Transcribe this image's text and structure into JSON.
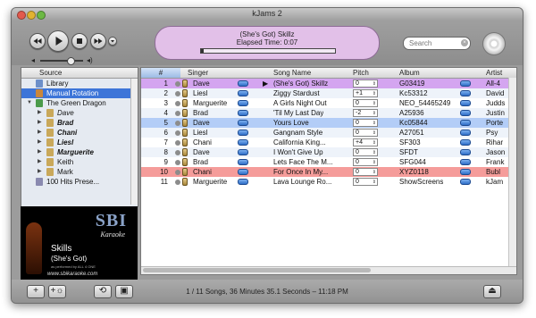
{
  "window": {
    "title": "kJams 2"
  },
  "now_playing": {
    "song": "(She's Got) Skillz",
    "elapsed": "Elapsed Time: 0:07",
    "progress": 0.02
  },
  "search": {
    "placeholder": "Search"
  },
  "sidebar": {
    "header": "Source",
    "items": [
      {
        "label": "Library",
        "indent": 0,
        "icon": "library-icon",
        "style": "normal",
        "selected": false,
        "triangle": ""
      },
      {
        "label": "Manual Rotation",
        "indent": 0,
        "icon": "manual-rotation-icon",
        "style": "normal",
        "selected": true,
        "triangle": ""
      },
      {
        "label": "The Green Dragon",
        "indent": 0,
        "icon": "venue-icon",
        "style": "normal",
        "selected": false,
        "triangle": "▼"
      },
      {
        "label": "Dave",
        "indent": 1,
        "icon": "singer-icon",
        "style": "italic",
        "selected": false,
        "triangle": "▶"
      },
      {
        "label": "Brad",
        "indent": 1,
        "icon": "singer-icon",
        "style": "bolditalic",
        "selected": false,
        "triangle": "▶"
      },
      {
        "label": "Chani",
        "indent": 1,
        "icon": "singer-icon",
        "style": "bolditalic",
        "selected": false,
        "triangle": "▶"
      },
      {
        "label": "Liesl",
        "indent": 1,
        "icon": "singer-icon",
        "style": "bolditalic",
        "selected": false,
        "triangle": "▶"
      },
      {
        "label": "Marguerite",
        "indent": 1,
        "icon": "singer-icon",
        "style": "bolditalic",
        "selected": false,
        "triangle": "▶"
      },
      {
        "label": "Keith",
        "indent": 1,
        "icon": "singer-icon",
        "style": "normal",
        "selected": false,
        "triangle": "▶"
      },
      {
        "label": "Mark",
        "indent": 1,
        "icon": "singer-icon",
        "style": "normal",
        "selected": false,
        "triangle": "▶"
      },
      {
        "label": "100 Hits Prese...",
        "indent": 0,
        "icon": "playlist-icon",
        "style": "normal",
        "selected": false,
        "triangle": ""
      }
    ]
  },
  "album_art": {
    "logo": "SBI",
    "logo_sub": "Karaoke",
    "title": "Skills",
    "subtitle": "(She's Got)",
    "credit": "as performed by ALL 4 ONE",
    "url": "www.sbikaraoke.com"
  },
  "columns": [
    "#",
    "Singer",
    "Song Name",
    "Pitch",
    "Album",
    "Artist"
  ],
  "rows": [
    {
      "num": "1",
      "singer": "Dave",
      "song": "(She's Got) Skillz",
      "pitch": "0",
      "album": "G03419",
      "artist": "All-4",
      "state": "playing",
      "speaker": "▶"
    },
    {
      "num": "2",
      "singer": "Liesl",
      "song": "Ziggy Stardust",
      "pitch": "+1",
      "album": "Kc53312",
      "artist": "David",
      "state": "",
      "speaker": ""
    },
    {
      "num": "3",
      "singer": "Marguerite",
      "song": "A Girls Night Out",
      "pitch": "0",
      "album": "NEO_54465249",
      "artist": "Judds",
      "state": "",
      "speaker": ""
    },
    {
      "num": "4",
      "singer": "Brad",
      "song": "'Til My Last Day",
      "pitch": "-2",
      "album": "A25936",
      "artist": "Justin",
      "state": "",
      "speaker": ""
    },
    {
      "num": "5",
      "singer": "Dave",
      "song": "Yours Love",
      "pitch": "0",
      "album": "Kc05844",
      "artist": "Porte",
      "state": "selected",
      "speaker": ""
    },
    {
      "num": "6",
      "singer": "Liesl",
      "song": "Gangnam Style",
      "pitch": "0",
      "album": "A27051",
      "artist": "Psy",
      "state": "",
      "speaker": ""
    },
    {
      "num": "7",
      "singer": "Chani",
      "song": "California King...",
      "pitch": "+4",
      "album": "SF303",
      "artist": "Rihar",
      "state": "",
      "speaker": ""
    },
    {
      "num": "8",
      "singer": "Dave",
      "song": "I Won't Give Up",
      "pitch": "0",
      "album": "SFDT",
      "artist": "Jason",
      "state": "",
      "speaker": ""
    },
    {
      "num": "9",
      "singer": "Brad",
      "song": "Lets Face The M...",
      "pitch": "0",
      "album": "SFG044",
      "artist": "Frank",
      "state": "",
      "speaker": ""
    },
    {
      "num": "10",
      "singer": "Chani",
      "song": "For Once In My...",
      "pitch": "0",
      "album": "XYZ0118",
      "artist": "Bubl",
      "state": "red",
      "speaker": ""
    },
    {
      "num": "11",
      "singer": "Marguerite",
      "song": "Lava Lounge Ro...",
      "pitch": "0",
      "album": "ShowScreens",
      "artist": "kJam",
      "state": "",
      "speaker": ""
    }
  ],
  "status": "1 / 11 Songs, 36 Minutes 35.1 Seconds – 11:18 PM",
  "colors": {
    "playing_row": "#d4a5f0",
    "selected_row": "#b3cdf7",
    "red_row": "#f59c9a",
    "alt_row": "#eef3fa",
    "lcd": "#e2c0e8"
  }
}
